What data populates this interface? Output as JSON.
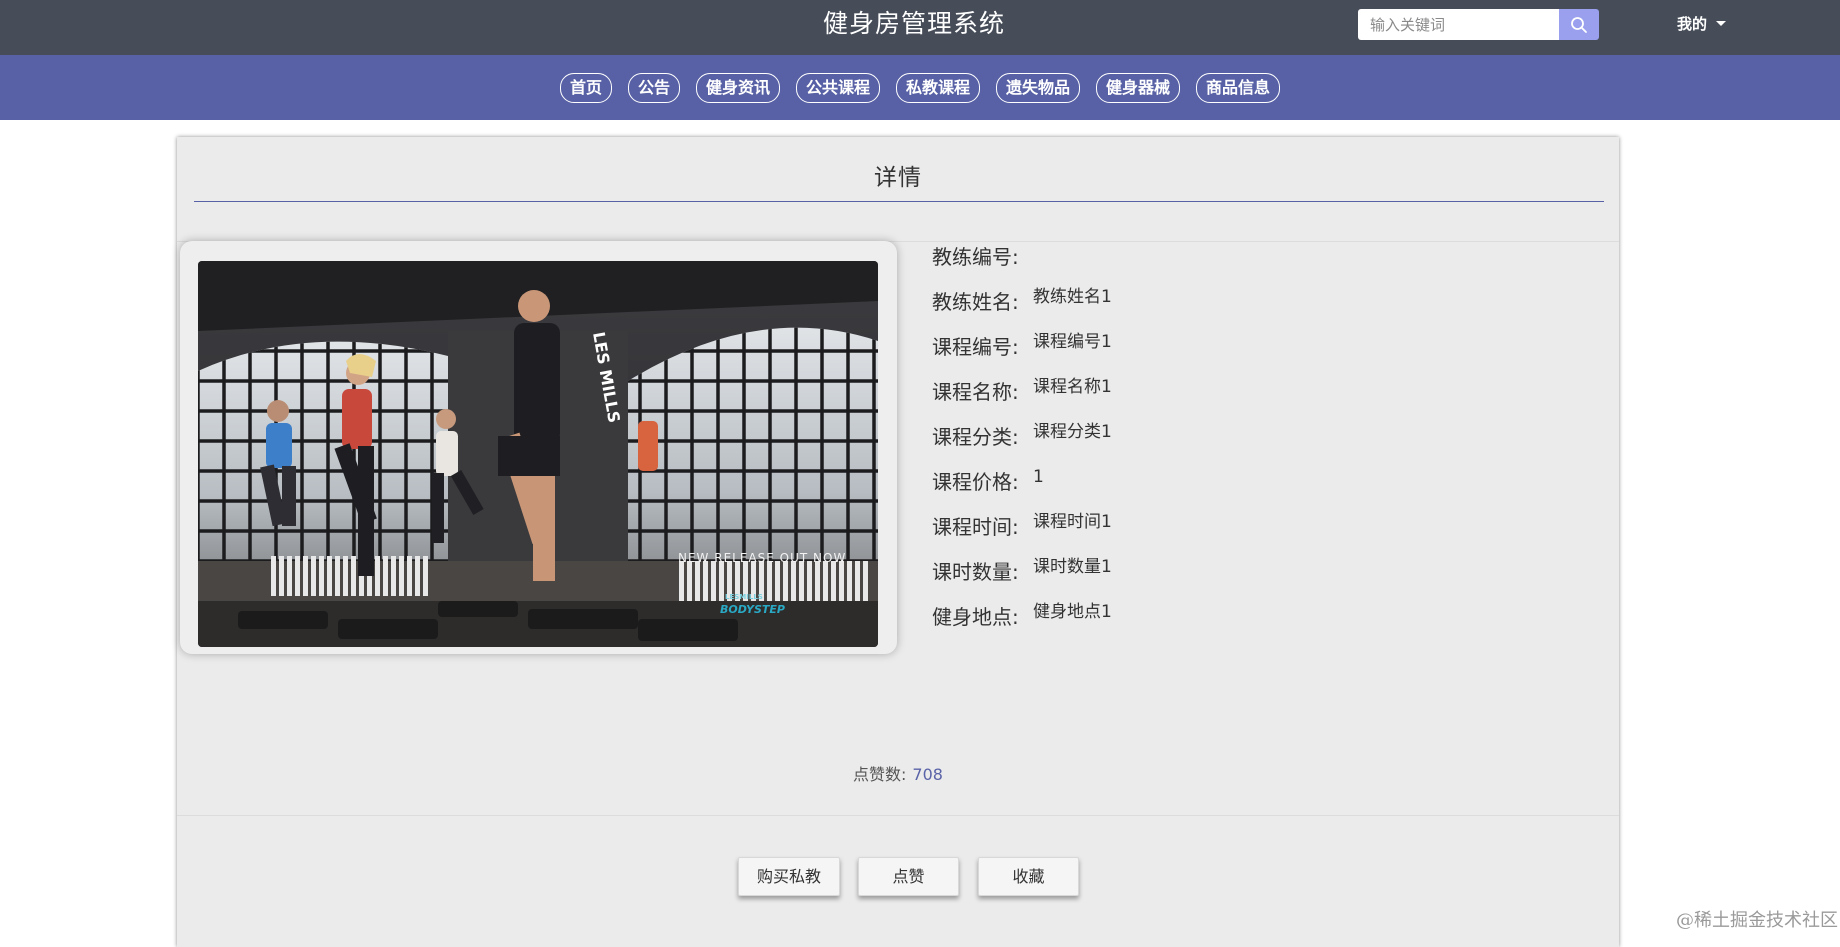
{
  "header": {
    "title": "健身房管理系统",
    "search": {
      "placeholder": "输入关键词",
      "value": ""
    },
    "user_menu": "我的"
  },
  "nav": [
    "首页",
    "公告",
    "健身资讯",
    "公共课程",
    "私教课程",
    "遗失物品",
    "健身器械",
    "商品信息"
  ],
  "detail": {
    "title": "详情",
    "image_text": {
      "tagline": "NEW RELEASE OUT NOW",
      "brand_small": "LESMILLS",
      "brand": "BODYSTEP",
      "shirt": "LES MILLS"
    },
    "fields": [
      {
        "label": "教练编号:",
        "value": ""
      },
      {
        "label": "教练姓名:",
        "value": "教练姓名1"
      },
      {
        "label": "课程编号:",
        "value": "课程编号1"
      },
      {
        "label": "课程名称:",
        "value": "课程名称1"
      },
      {
        "label": "课程分类:",
        "value": "课程分类1"
      },
      {
        "label": "课程价格:",
        "value": "1"
      },
      {
        "label": "课程时间:",
        "value": "课程时间1"
      },
      {
        "label": "课时数量:",
        "value": "课时数量1"
      },
      {
        "label": "健身地点:",
        "value": "健身地点1"
      }
    ],
    "likes_label": "点赞数:",
    "likes_count": "708"
  },
  "actions": {
    "buy": "购买私教",
    "like": "点赞",
    "favorite": "收藏"
  },
  "watermark": "@稀土掘金技术社区",
  "colors": {
    "topbar": "#464d59",
    "navbar": "#5861a5",
    "search_button": "#9aa0ee",
    "panel": "#ebebeb",
    "accent": "#5a63a8"
  }
}
